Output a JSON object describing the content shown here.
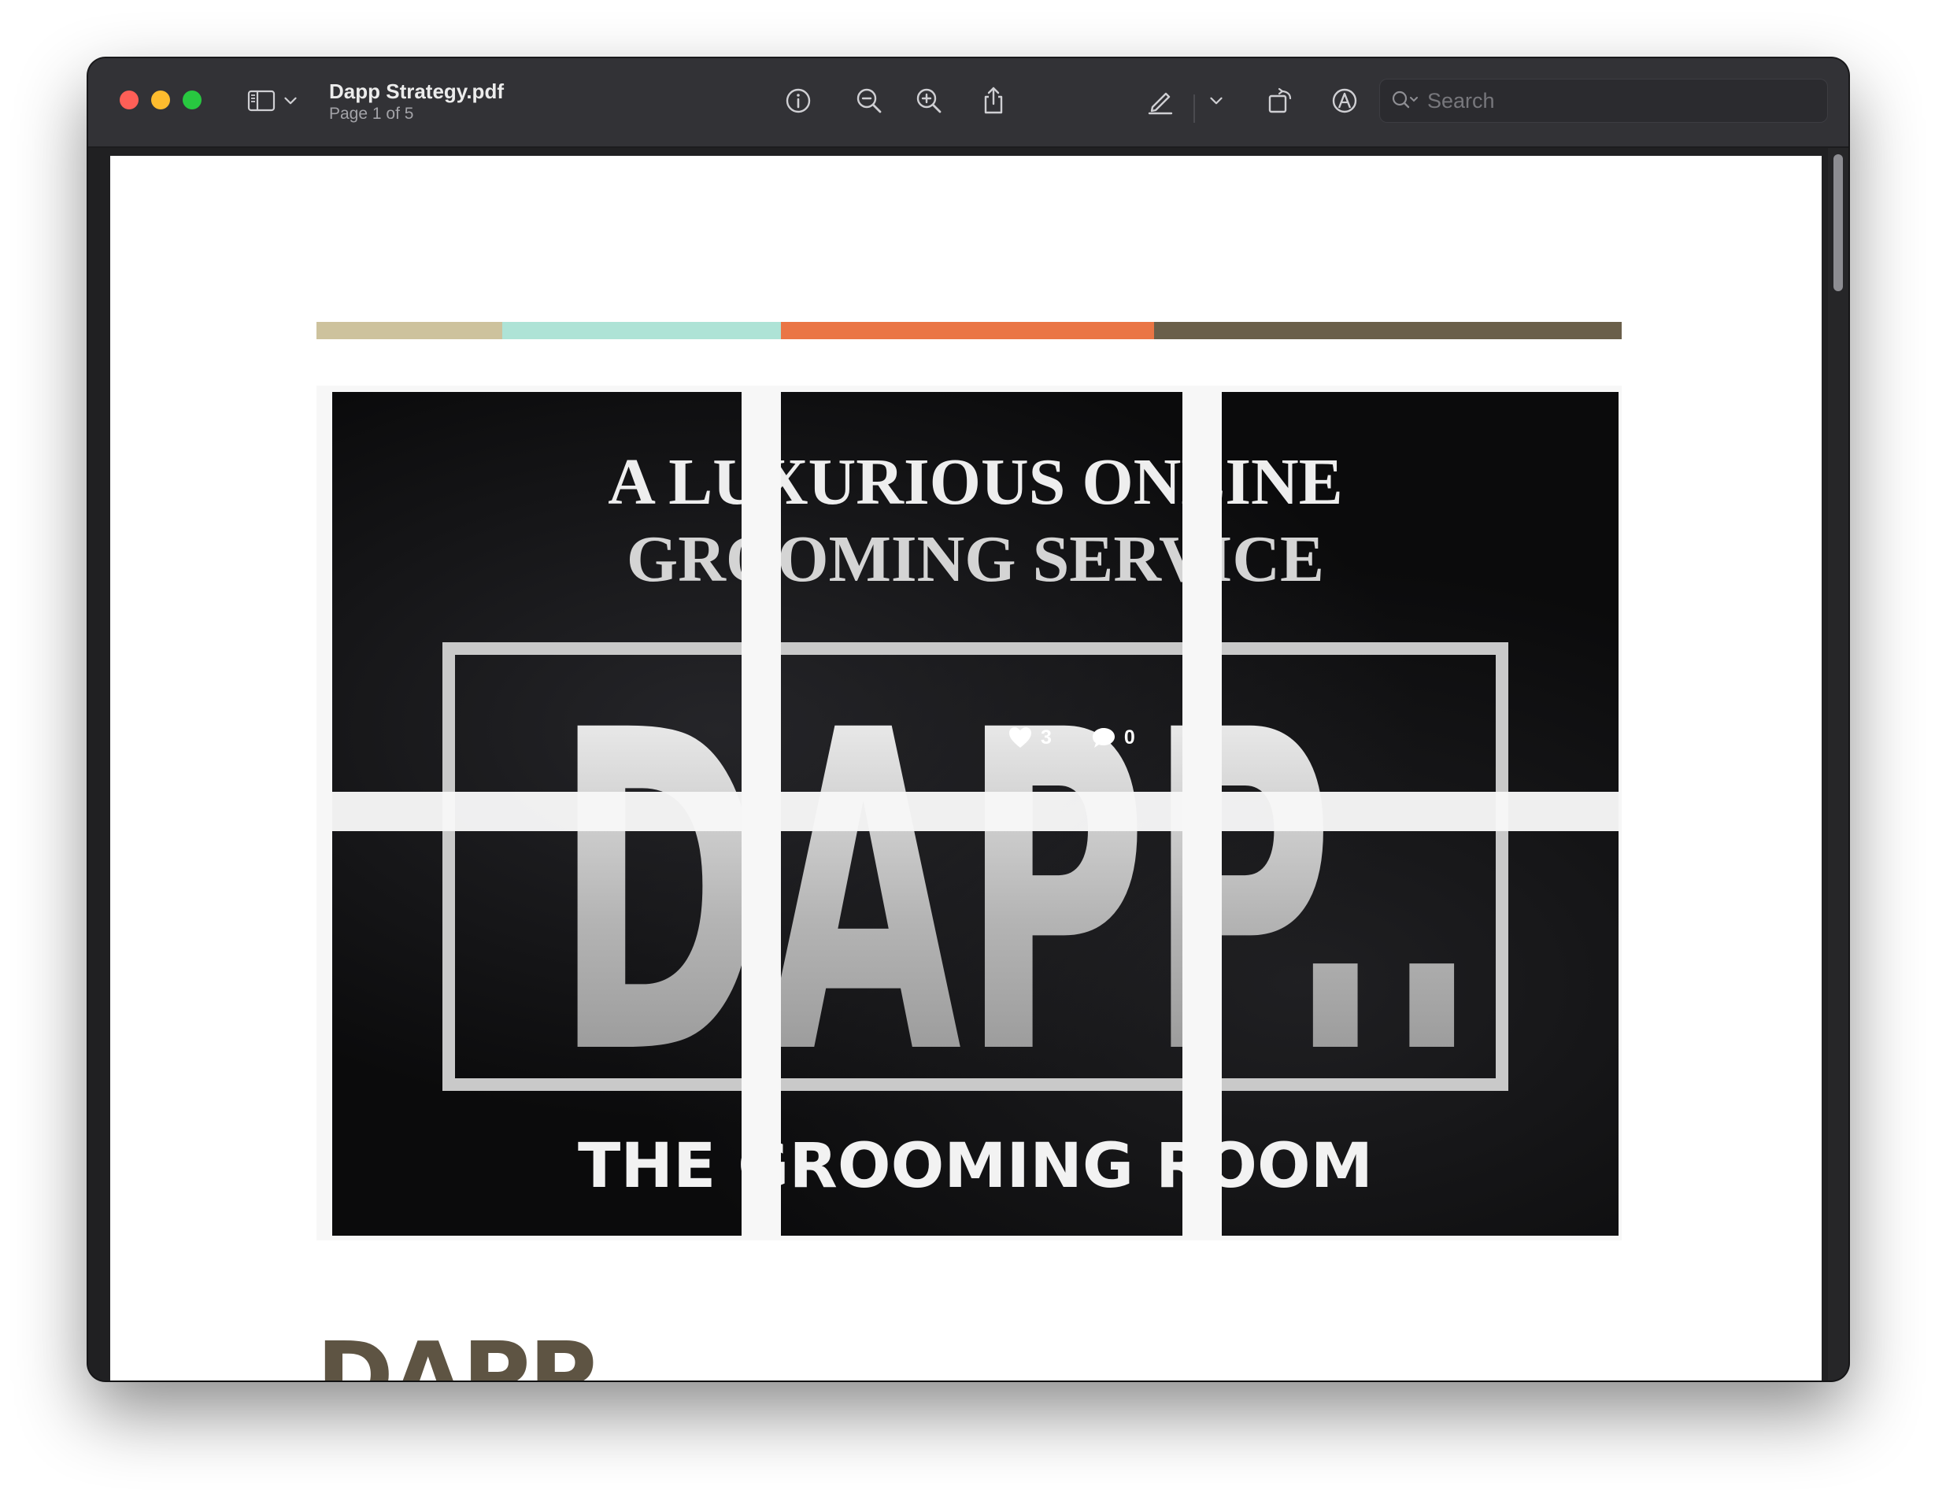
{
  "window": {
    "title": "Dapp Strategy.pdf",
    "subtitle": "Page 1 of 5"
  },
  "toolbar": {
    "icons": [
      "sidebar-toggle-icon",
      "chevron-down-icon",
      "info-icon",
      "zoom-out-icon",
      "zoom-in-icon",
      "share-icon",
      "highlight-pen-icon",
      "chevron-down-icon",
      "rotate-icon",
      "markup-icon",
      "form-fill-icon",
      "search-icon"
    ],
    "search_placeholder": "Search"
  },
  "page": {
    "color_bar": [
      {
        "color": "#cdc29d"
      },
      {
        "color": "#aee3d6"
      },
      {
        "color": "#ea7545"
      },
      {
        "color": "#6a5f4a"
      }
    ],
    "poster": {
      "tagline_line1": "A LUXURIOUS ONLINE",
      "tagline_line2": "GROOMING SERVICE",
      "brand": "DAPP..",
      "footer": "THE GROOMING ROOM"
    },
    "overlay": {
      "likes": "3",
      "comments": "0"
    },
    "heading_peek": "DAPP"
  }
}
